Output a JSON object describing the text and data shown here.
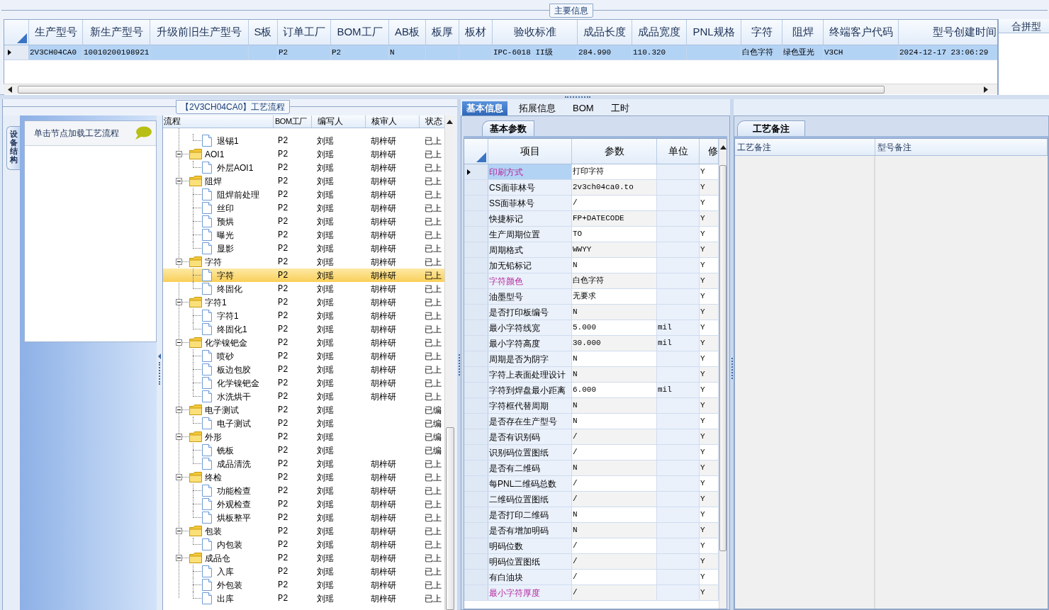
{
  "main_info": {
    "title": "主要信息",
    "columns": [
      "生产型号",
      "新生产型号",
      "升级前旧生产型号",
      "S板",
      "订单工厂",
      "BOM工厂",
      "AB板",
      "板厚",
      "板材",
      "验收标准",
      "成品长度",
      "成品宽度",
      "PNL规格",
      "字符",
      "阻焊",
      "终端客户代码",
      "型号创建时间"
    ],
    "rows": [
      {
        "selected": true,
        "cells": [
          "2V3CH04CA0",
          "10010200198921",
          "",
          "",
          "P2",
          "P2",
          "N",
          "",
          "",
          "IPC-6018 II级",
          "284.990",
          "110.320",
          "",
          "白色字符",
          "绿色亚光",
          "V3CH",
          "2024-12-17 23:06:29"
        ]
      }
    ]
  },
  "merge_panel": {
    "title": "合拼型"
  },
  "process_flow": {
    "title": "【2V3CH04CA0】工艺流程",
    "side_tab": "设备结构",
    "hint": "单击节点加载工艺流程",
    "columns": [
      "流程",
      "BOM工厂",
      "编写人",
      "核审人",
      "状态"
    ],
    "tree": [
      {
        "children": [
          {
            "name": "退锡1",
            "bom": "P2",
            "writer": "刘瑶",
            "reviewer": "胡梓研",
            "status": "已上",
            "selected": false
          }
        ]
      },
      {
        "name": "AOI1",
        "bom": "P2",
        "writer": "刘瑶",
        "reviewer": "胡梓研",
        "status": "已上",
        "selected": false,
        "expanded": true,
        "children": [
          {
            "name": "外层AOI1",
            "bom": "P2",
            "writer": "刘瑶",
            "reviewer": "胡梓研",
            "status": "已上",
            "selected": false
          }
        ]
      },
      {
        "name": "阻焊",
        "bom": "P2",
        "writer": "刘瑶",
        "reviewer": "胡梓研",
        "status": "已上",
        "selected": false,
        "expanded": true,
        "children": [
          {
            "name": "阻焊前处理",
            "bom": "P2",
            "writer": "刘瑶",
            "reviewer": "胡梓研",
            "status": "已上",
            "selected": false
          },
          {
            "name": "丝印",
            "bom": "P2",
            "writer": "刘瑶",
            "reviewer": "胡梓研",
            "status": "已上",
            "selected": false
          },
          {
            "name": "预烘",
            "bom": "P2",
            "writer": "刘瑶",
            "reviewer": "胡梓研",
            "status": "已上",
            "selected": false
          },
          {
            "name": "曝光",
            "bom": "P2",
            "writer": "刘瑶",
            "reviewer": "胡梓研",
            "status": "已上",
            "selected": false
          },
          {
            "name": "显影",
            "bom": "P2",
            "writer": "刘瑶",
            "reviewer": "胡梓研",
            "status": "已上",
            "selected": false
          }
        ]
      },
      {
        "name": "字符",
        "bom": "P2",
        "writer": "刘瑶",
        "reviewer": "胡梓研",
        "status": "已上",
        "selected": false,
        "expanded": true,
        "children": [
          {
            "name": "字符",
            "bom": "P2",
            "writer": "刘瑶",
            "reviewer": "胡梓研",
            "status": "已上",
            "selected": true
          },
          {
            "name": "终固化",
            "bom": "P2",
            "writer": "刘瑶",
            "reviewer": "胡梓研",
            "status": "已上",
            "selected": false
          }
        ]
      },
      {
        "name": "字符1",
        "bom": "P2",
        "writer": "刘瑶",
        "reviewer": "胡梓研",
        "status": "已上",
        "selected": false,
        "expanded": true,
        "children": [
          {
            "name": "字符1",
            "bom": "P2",
            "writer": "刘瑶",
            "reviewer": "胡梓研",
            "status": "已上",
            "selected": false
          },
          {
            "name": "终固化1",
            "bom": "P2",
            "writer": "刘瑶",
            "reviewer": "胡梓研",
            "status": "已上",
            "selected": false
          }
        ]
      },
      {
        "name": "化学镍钯金",
        "bom": "P2",
        "writer": "刘瑶",
        "reviewer": "胡梓研",
        "status": "已上",
        "selected": false,
        "expanded": true,
        "children": [
          {
            "name": "喷砂",
            "bom": "P2",
            "writer": "刘瑶",
            "reviewer": "胡梓研",
            "status": "已上",
            "selected": false
          },
          {
            "name": "板边包胶",
            "bom": "P2",
            "writer": "刘瑶",
            "reviewer": "胡梓研",
            "status": "已上",
            "selected": false
          },
          {
            "name": "化学镍钯金",
            "bom": "P2",
            "writer": "刘瑶",
            "reviewer": "胡梓研",
            "status": "已上",
            "selected": false
          },
          {
            "name": "水洗烘干",
            "bom": "P2",
            "writer": "刘瑶",
            "reviewer": "胡梓研",
            "status": "已上",
            "selected": false
          }
        ]
      },
      {
        "name": "电子测试",
        "bom": "P2",
        "writer": "刘瑶",
        "status": "已编",
        "selected": false,
        "expanded": true,
        "children": [
          {
            "name": "电子测试",
            "bom": "P2",
            "writer": "刘瑶",
            "status": "已编",
            "selected": false
          }
        ]
      },
      {
        "name": "外形",
        "bom": "P2",
        "writer": "刘瑶",
        "status": "已编",
        "selected": false,
        "expanded": true,
        "children": [
          {
            "name": "铣板",
            "bom": "P2",
            "writer": "刘瑶",
            "status": "已编",
            "selected": false
          },
          {
            "name": "成品清洗",
            "bom": "P2",
            "writer": "刘瑶",
            "reviewer": "胡梓研",
            "status": "已上",
            "selected": false
          }
        ]
      },
      {
        "name": "终检",
        "bom": "P2",
        "writer": "刘瑶",
        "reviewer": "胡梓研",
        "status": "已上",
        "selected": false,
        "expanded": true,
        "children": [
          {
            "name": "功能检查",
            "bom": "P2",
            "writer": "刘瑶",
            "reviewer": "胡梓研",
            "status": "已上",
            "selected": false
          },
          {
            "name": "外观检查",
            "bom": "P2",
            "writer": "刘瑶",
            "reviewer": "胡梓研",
            "status": "已上",
            "selected": false
          },
          {
            "name": "烘板整平",
            "bom": "P2",
            "writer": "刘瑶",
            "reviewer": "胡梓研",
            "status": "已上",
            "selected": false
          }
        ]
      },
      {
        "name": "包装",
        "bom": "P2",
        "writer": "刘瑶",
        "reviewer": "胡梓研",
        "status": "已上",
        "selected": false,
        "expanded": true,
        "children": [
          {
            "name": "内包装",
            "bom": "P2",
            "writer": "刘瑶",
            "reviewer": "胡梓研",
            "status": "已上",
            "selected": false
          }
        ]
      },
      {
        "name": "成品仓",
        "bom": "P2",
        "writer": "刘瑶",
        "reviewer": "胡梓研",
        "status": "已上",
        "selected": false,
        "expanded": true,
        "children": [
          {
            "name": "入库",
            "bom": "P2",
            "writer": "刘瑶",
            "reviewer": "胡梓研",
            "status": "已上",
            "selected": false
          },
          {
            "name": "外包装",
            "bom": "P2",
            "writer": "刘瑶",
            "reviewer": "胡梓研",
            "status": "已上",
            "selected": false
          },
          {
            "name": "出库",
            "bom": "P2",
            "writer": "刘瑶",
            "reviewer": "胡梓研",
            "status": "已上",
            "selected": false
          }
        ]
      }
    ]
  },
  "detail_tabs": [
    {
      "label": "基本信息",
      "selected": true
    },
    {
      "label": "拓展信息",
      "selected": false
    },
    {
      "label": "BOM",
      "selected": false
    },
    {
      "label": "工时",
      "selected": false
    }
  ],
  "params": {
    "tab": "基本参数",
    "columns": [
      "项目",
      "参数",
      "单位",
      "修"
    ],
    "rows": [
      {
        "item": "印刷方式",
        "value": "打印字符",
        "flag": "Y",
        "emphasized": true,
        "selected": true
      },
      {
        "item": "CS面菲林号",
        "value": "2v3ch04ca0.to",
        "flag": "Y",
        "emphasized": false,
        "selected": false
      },
      {
        "item": "SS面菲林号",
        "value": "/",
        "flag": "Y",
        "emphasized": false,
        "selected": false
      },
      {
        "item": "快捷标记",
        "value": "FP+DATECODE",
        "flag": "Y",
        "emphasized": false,
        "selected": false
      },
      {
        "item": "生产周期位置",
        "value": "TO",
        "flag": "Y",
        "emphasized": false,
        "selected": false
      },
      {
        "item": "周期格式",
        "value": "WWYY",
        "flag": "Y",
        "emphasized": false,
        "selected": false
      },
      {
        "item": "加无铅标记",
        "value": "N",
        "flag": "Y",
        "emphasized": false,
        "selected": false
      },
      {
        "item": "字符颜色",
        "value": "白色字符",
        "flag": "Y",
        "emphasized": true,
        "selected": false
      },
      {
        "item": "油墨型号",
        "value": "无要求",
        "flag": "Y",
        "emphasized": false,
        "selected": false
      },
      {
        "item": "是否打印板编号",
        "value": "N",
        "flag": "Y",
        "emphasized": false,
        "selected": false
      },
      {
        "item": "最小字符线宽",
        "value": "5.000",
        "unit": "mil",
        "flag": "Y",
        "emphasized": false,
        "selected": false
      },
      {
        "item": "最小字符高度",
        "value": "30.000",
        "unit": "mil",
        "flag": "Y",
        "emphasized": false,
        "selected": false
      },
      {
        "item": "周期是否为阴字",
        "value": "N",
        "flag": "Y",
        "emphasized": false,
        "selected": false
      },
      {
        "item": "字符上表面处理设计",
        "value": "N",
        "flag": "Y",
        "emphasized": false,
        "selected": false
      },
      {
        "item": "字符到焊盘最小距离",
        "value": "6.000",
        "unit": "mil",
        "flag": "Y",
        "emphasized": false,
        "selected": false
      },
      {
        "item": "字符框代替周期",
        "value": "N",
        "flag": "Y",
        "emphasized": false,
        "selected": false
      },
      {
        "item": "是否存在生产型号",
        "value": "N",
        "flag": "Y",
        "emphasized": false,
        "selected": false
      },
      {
        "item": "是否有识别码",
        "value": "/",
        "flag": "Y",
        "emphasized": false,
        "selected": false
      },
      {
        "item": "识别码位置图纸",
        "value": "/",
        "flag": "Y",
        "emphasized": false,
        "selected": false
      },
      {
        "item": "是否有二维码",
        "value": "N",
        "flag": "Y",
        "emphasized": false,
        "selected": false
      },
      {
        "item": "每PNL二维码总数",
        "value": "/",
        "flag": "Y",
        "emphasized": false,
        "selected": false
      },
      {
        "item": "二维码位置图纸",
        "value": "/",
        "flag": "Y",
        "emphasized": false,
        "selected": false
      },
      {
        "item": "是否打印二维码",
        "value": "N",
        "flag": "Y",
        "emphasized": false,
        "selected": false
      },
      {
        "item": "是否有增加明码",
        "value": "N",
        "flag": "Y",
        "emphasized": false,
        "selected": false
      },
      {
        "item": "明码位数",
        "value": "/",
        "flag": "Y",
        "emphasized": false,
        "selected": false
      },
      {
        "item": "明码位置图纸",
        "value": "/",
        "flag": "Y",
        "emphasized": false,
        "selected": false
      },
      {
        "item": "有白油块",
        "value": "/",
        "flag": "Y",
        "emphasized": false,
        "selected": false
      },
      {
        "item": "最小字符厚度",
        "value": "/",
        "flag": "Y",
        "emphasized": true,
        "selected": false
      }
    ]
  },
  "remarks": {
    "tab": "工艺备注",
    "columns": [
      "工艺备注",
      "型号备注"
    ]
  }
}
